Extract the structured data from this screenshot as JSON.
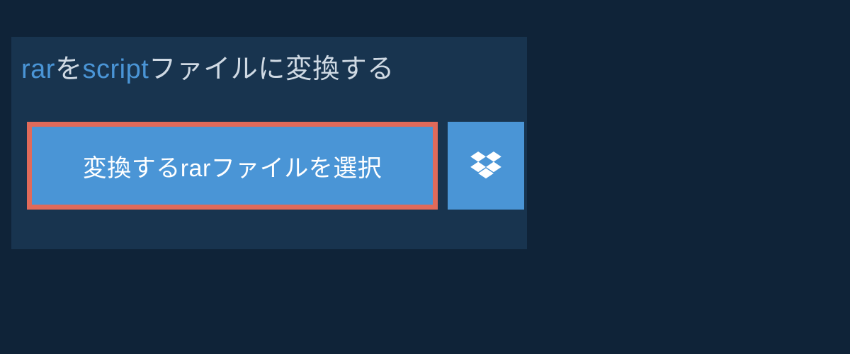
{
  "heading": {
    "prefix": "rar",
    "mid1": "を",
    "keyword": "script",
    "suffix": "ファイルに変換する"
  },
  "buttons": {
    "select_prefix": "変換する",
    "select_keyword": "rar",
    "select_suffix": "ファイルを選択"
  },
  "colors": {
    "background": "#0f2338",
    "panel": "#18344f",
    "accent": "#4a95d6",
    "highlight_border": "#e06a5a",
    "text_light": "#cfd9e3"
  }
}
